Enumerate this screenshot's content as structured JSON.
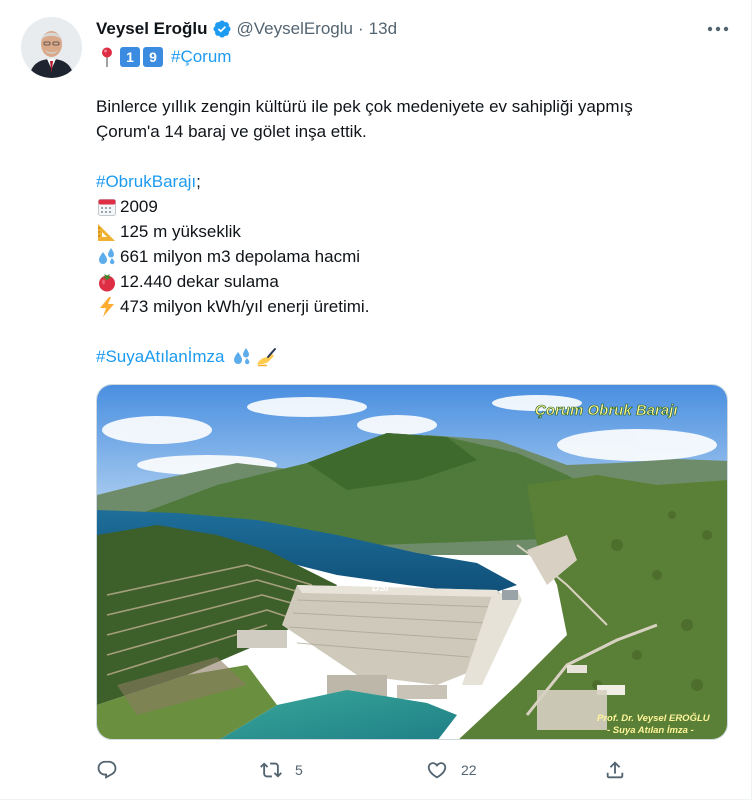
{
  "tweet": {
    "author_name": "Veysel Eroğlu",
    "handle": "@VeyselEroglu",
    "separator": "·",
    "time": "13d",
    "top_line": {
      "keycap_1": "1",
      "keycap_2": "9",
      "hashtag": "#Çorum"
    },
    "lines": {
      "intro_1": "Binlerce yıllık zengin kültürü ile pek çok medeniyete ev sahipliği yapmış",
      "intro_2": "Çorum'a 14 baraj ve gölet inşa ettik.",
      "hashtag_dam": "#ObrukBarajı",
      "hashtag_dam_suffix": ";",
      "year": " 2009",
      "height": "125 m yükseklik",
      "storage": "661 milyon m3 depolama hacmi",
      "irrigation": "12.440 dekar sulama",
      "energy": "473 milyon kWh/yıl enerji üretimi.",
      "hashtag_sign": "#SuyaAtılanİmza"
    },
    "media": {
      "title_overlay": "Çorum Obruk Barajı",
      "dam_label": "DSI",
      "credit_line_1": "Prof. Dr. Veysel EROĞLU",
      "credit_line_2": "- Suya Atılan İmza -"
    },
    "actions": {
      "replies": "",
      "retweets": "5",
      "likes": "22"
    },
    "icons": {
      "verified": "verified-badge-icon",
      "more": "more-horizontal-icon",
      "pin": "round-pushpin-icon",
      "calendar": "calendar-icon",
      "ruler": "triangular-ruler-icon",
      "droplets": "sweat-droplets-icon",
      "tomato": "tomato-icon",
      "lightning": "high-voltage-icon",
      "writing": "writing-hand-icon",
      "reply": "reply-icon",
      "retweet": "retweet-icon",
      "like": "heart-icon",
      "share": "share-icon"
    },
    "colors": {
      "accent": "#1d9bf0",
      "text": "#0f1419",
      "muted": "#536471"
    }
  }
}
